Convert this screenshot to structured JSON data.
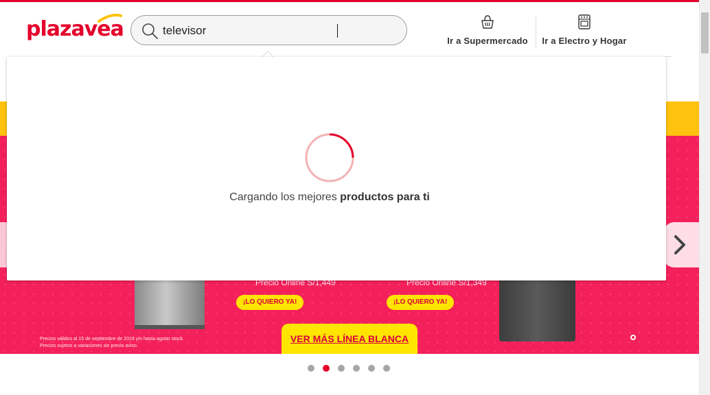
{
  "brand": {
    "name": "plazavea",
    "color": "#e4002b",
    "accent": "#ffc20e"
  },
  "search": {
    "value": "televisor",
    "placeholder": ""
  },
  "nav": {
    "supermercado": {
      "label": "Ir a Supermercado",
      "icon": "basket-icon"
    },
    "electro": {
      "label": "Ir a Electro y Hogar",
      "icon": "stove-icon"
    }
  },
  "loading": {
    "text_regular": "Cargando los mejores ",
    "text_bold": "productos para ti"
  },
  "banner": {
    "price_1": "Precio Online S/1,449",
    "price_2": "Precio Online S/1,349",
    "cta_1": "¡LO QUIERO YA!",
    "cta_2": "¡LO QUIERO YA!",
    "cta_main": "VER MÁS LÍNEA BLANCA",
    "disclaimer_1": "Precios válidos al 15 de septiembre de 2019 y/o hasta agotar stock.",
    "disclaimer_2": "Precios sujetos a variaciones sin previo aviso."
  },
  "carousel": {
    "slide_count": 6,
    "active_index": 1
  }
}
